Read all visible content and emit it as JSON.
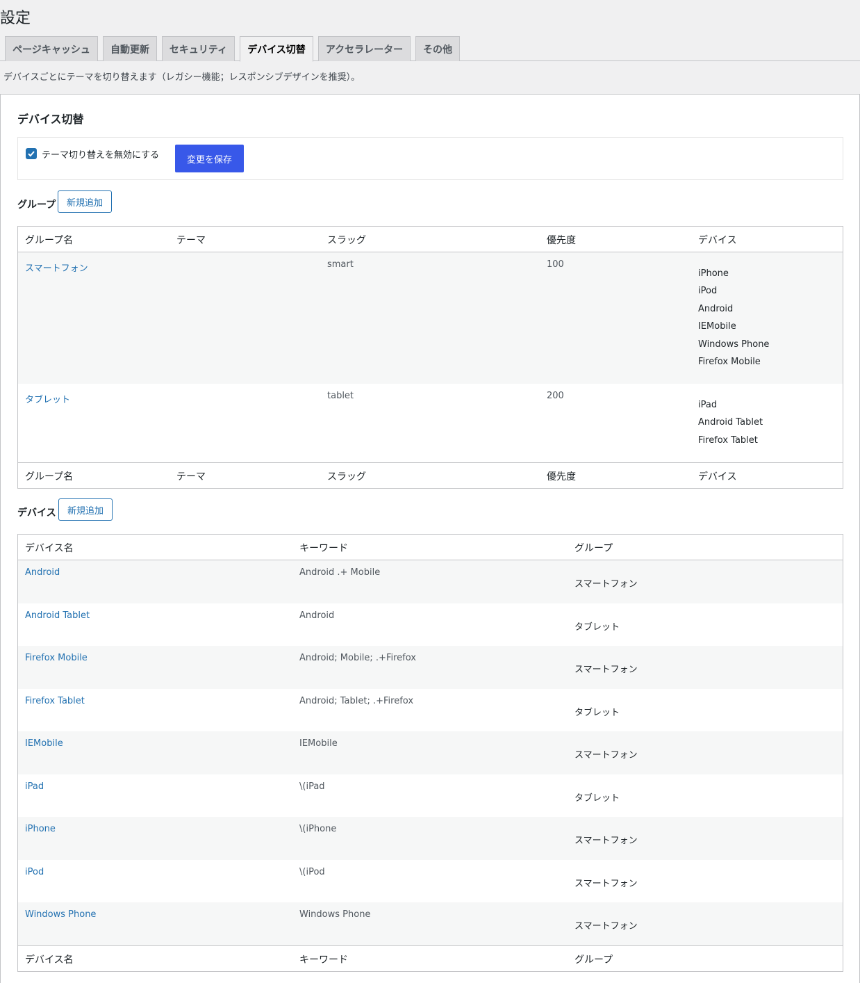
{
  "page_title": "設定",
  "tabs": [
    {
      "label": "ページキャッシュ",
      "active": false
    },
    {
      "label": "自動更新",
      "active": false
    },
    {
      "label": "セキュリティ",
      "active": false
    },
    {
      "label": "デバイス切替",
      "active": true
    },
    {
      "label": "アクセラレーター",
      "active": false
    },
    {
      "label": "その他",
      "active": false
    }
  ],
  "description": "デバイスごとにテーマを切り替えます（レガシー機能；レスポンシブデザインを推奨）。",
  "section_title": "デバイス切替",
  "toggle": {
    "label": "テーマ切り替えを無効にする",
    "checked": true,
    "save_label": "変更を保存"
  },
  "groups": {
    "heading": "グループ",
    "add_label": "新規追加",
    "columns": [
      "グループ名",
      "テーマ",
      "スラッグ",
      "優先度",
      "デバイス"
    ],
    "rows": [
      {
        "name": "スマートフォン",
        "theme": "",
        "slug": "smart",
        "priority": "100",
        "devices": [
          "iPhone",
          "iPod",
          "Android",
          "IEMobile",
          "Windows Phone",
          "Firefox Mobile"
        ]
      },
      {
        "name": "タブレット",
        "theme": "",
        "slug": "tablet",
        "priority": "200",
        "devices": [
          "iPad",
          "Android Tablet",
          "Firefox Tablet"
        ]
      }
    ]
  },
  "devices": {
    "heading": "デバイス",
    "add_label": "新規追加",
    "columns": [
      "デバイス名",
      "キーワード",
      "グループ"
    ],
    "rows": [
      {
        "name": "Android",
        "keyword": "Android .+ Mobile",
        "group": "スマートフォン"
      },
      {
        "name": "Android Tablet",
        "keyword": "Android",
        "group": "タブレット"
      },
      {
        "name": "Firefox Mobile",
        "keyword": "Android; Mobile; .+Firefox",
        "group": "スマートフォン"
      },
      {
        "name": "Firefox Tablet",
        "keyword": "Android; Tablet; .+Firefox",
        "group": "タブレット"
      },
      {
        "name": "IEMobile",
        "keyword": "IEMobile",
        "group": "スマートフォン"
      },
      {
        "name": "iPad",
        "keyword": "\\(iPad",
        "group": "タブレット"
      },
      {
        "name": "iPhone",
        "keyword": "\\(iPhone",
        "group": "スマートフォン"
      },
      {
        "name": "iPod",
        "keyword": "\\(iPod",
        "group": "スマートフォン"
      },
      {
        "name": "Windows Phone",
        "keyword": "Windows Phone",
        "group": "スマートフォン"
      }
    ]
  },
  "colors": {
    "accent": "#2271b1",
    "save_button": "#3858e9",
    "background": "#f0f0f1"
  }
}
